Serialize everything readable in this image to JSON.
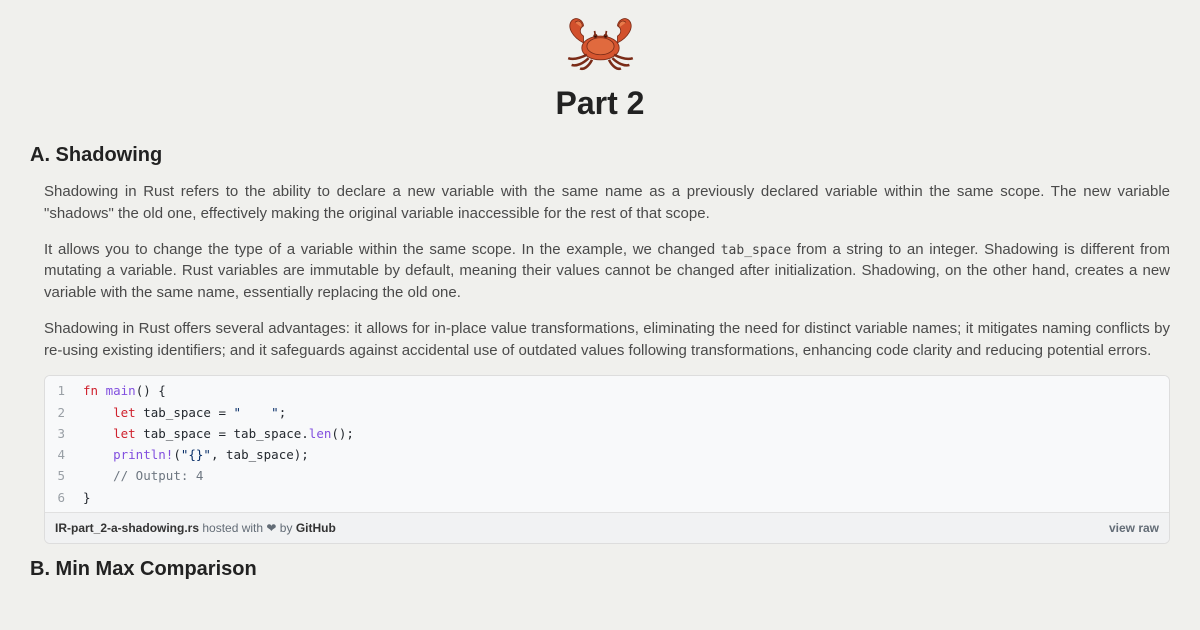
{
  "header": {
    "icon_name": "rust-crab-icon",
    "title": "Part 2"
  },
  "sections": {
    "a": {
      "heading": "A. Shadowing",
      "para1": "Shadowing in Rust refers to the ability to declare a new variable with the same name as a previously declared variable within the same scope. The new variable \"shadows\" the old one, effectively making the original variable inaccessible for the rest of that scope.",
      "para2_a": "It allows you to change the type of a variable within the same scope. In the example, we changed ",
      "para2_code": "tab_space",
      "para2_b": " from a string to an integer. Shadowing is different from mutating a variable. Rust variables are immutable by default, meaning their values cannot be changed after initialization. Shadowing, on the other hand, creates a new variable with the same name, essentially replacing the old one.",
      "para3": "Shadowing in Rust offers several advantages: it allows for in-place value transformations, eliminating the need for distinct variable names; it mitigates naming conflicts by re-using existing identifiers; and it safeguards against accidental use of outdated values following transformations, enhancing code clarity and reducing potential errors."
    },
    "b": {
      "heading": "B. Min Max Comparison"
    }
  },
  "gist": {
    "lines": {
      "l1": {
        "n": "1",
        "kw": "fn ",
        "fn": "main",
        "rest": "() {"
      },
      "l2": {
        "n": "2",
        "indent": "    ",
        "kw": "let ",
        "ident": "tab_space ",
        "eq": "= ",
        "str": "\"    \"",
        "semi": ";"
      },
      "l3": {
        "n": "3",
        "indent": "    ",
        "kw": "let ",
        "ident": "tab_space ",
        "eq": "= tab_space.",
        "fn": "len",
        "tail": "();"
      },
      "l4": {
        "n": "4",
        "indent": "    ",
        "macro": "println!",
        "open": "(",
        "str": "\"{}\"",
        "rest": ", tab_space);"
      },
      "l5": {
        "n": "5",
        "indent": "    ",
        "cmt": "// Output: 4"
      },
      "l6": {
        "n": "6",
        "brace": "}"
      }
    },
    "meta": {
      "filename": "IR-part_2-a-shadowing.rs",
      "hosted_prefix": " hosted with ",
      "heart": "❤",
      "hosted_suffix": " by ",
      "host": "GitHub",
      "viewraw": "view raw"
    }
  }
}
